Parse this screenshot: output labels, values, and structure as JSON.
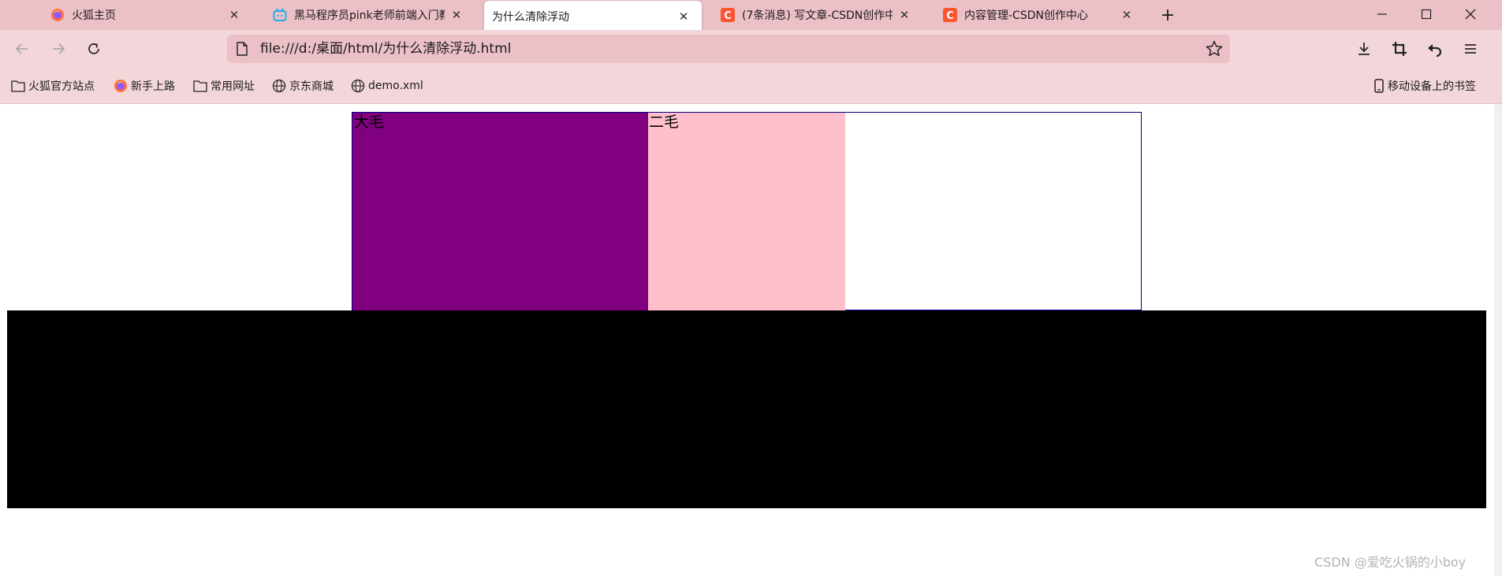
{
  "tabs": [
    {
      "title": "火狐主页",
      "icon": "firefox-icon",
      "active": false
    },
    {
      "title": "黑马程序员pink老师前端入门教",
      "icon": "bilibili-icon",
      "active": false
    },
    {
      "title": "为什么清除浮动",
      "icon": "none",
      "active": true
    },
    {
      "title": "(7条消息) 写文章-CSDN创作中",
      "icon": "csdn-icon",
      "active": false
    },
    {
      "title": "内容管理-CSDN创作中心",
      "icon": "csdn-icon",
      "active": false
    }
  ],
  "nav": {
    "url": "file:///d:/桌面/html/为什么清除浮动.html"
  },
  "bookmarks": [
    {
      "label": "火狐官方站点",
      "icon": "folder-icon"
    },
    {
      "label": "新手上路",
      "icon": "firefox-icon"
    },
    {
      "label": "常用网址",
      "icon": "folder-icon"
    },
    {
      "label": "京东商城",
      "icon": "globe-icon"
    },
    {
      "label": "demo.xml",
      "icon": "globe-icon"
    }
  ],
  "mobile_bookmarks": "移动设备上的书签",
  "content": {
    "box1_label": "大毛",
    "box2_label": "二毛"
  },
  "watermark": "CSDN @爱吃火锅的小boy",
  "colors": {
    "chrome": "#ecc0c7",
    "toolbar": "#f2d6da",
    "purple": "#800080",
    "pink": "#ffc0cb",
    "black": "#000000",
    "border": "#00008b",
    "csdn": "#fc5531"
  }
}
